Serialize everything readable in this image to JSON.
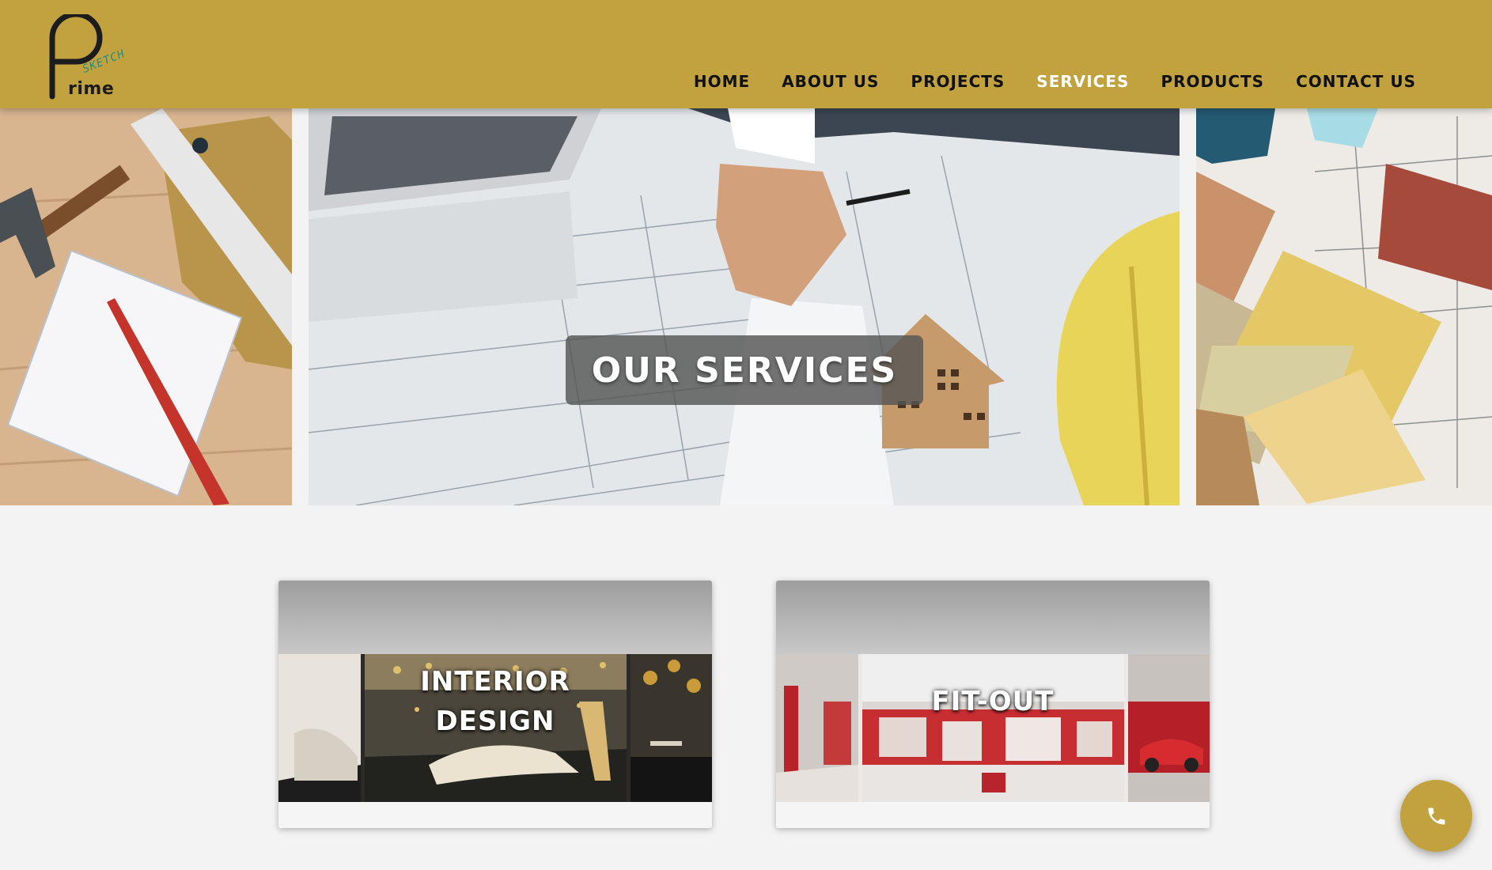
{
  "brand": {
    "logo_word": "rime",
    "logo_sub": "SKETCH"
  },
  "nav": {
    "items": [
      {
        "label": "HOME"
      },
      {
        "label": "ABOUT US"
      },
      {
        "label": "PROJECTS"
      },
      {
        "label": "SERVICES"
      },
      {
        "label": "PRODUCTS"
      },
      {
        "label": "CONTACT US"
      }
    ],
    "active": "SERVICES"
  },
  "hero": {
    "title": "OUR SERVICES"
  },
  "services": [
    {
      "title_line1": "INTERIOR",
      "title_line2": "DESIGN"
    },
    {
      "title_line1": "FIT-OUT"
    }
  ],
  "colors": {
    "brand_gold": "#c2a23f",
    "page_bg": "#f3f3f3"
  },
  "icons": {
    "call_button": "phone-icon"
  }
}
